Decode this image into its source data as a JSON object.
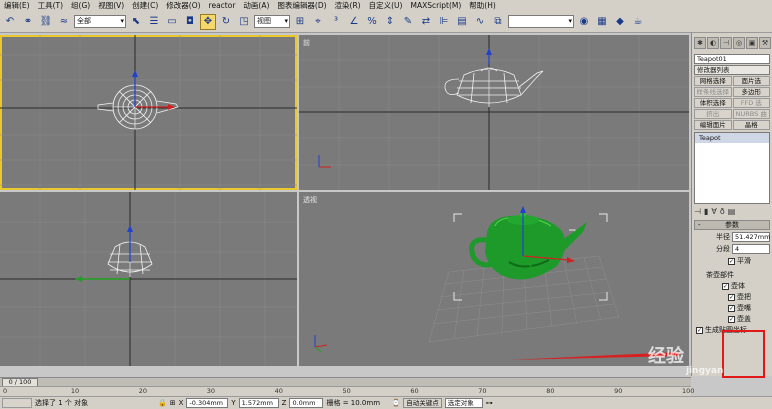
{
  "menu": [
    "编辑(E)",
    "工具(T)",
    "组(G)",
    "视图(V)",
    "创建(C)",
    "修改器(O)",
    "reactor",
    "动画(A)",
    "图表编辑器(D)",
    "渲染(R)",
    "自定义(U)",
    "MAXScript(M)",
    "帮助(H)"
  ],
  "toolbar": {
    "filter_select": "全部",
    "coord_select": "视图",
    "named_selection": ""
  },
  "viewports": {
    "top_label": "",
    "front_label": "前",
    "left_label": "",
    "perspective_label": "透视"
  },
  "command_panel": {
    "object_name": "Teapot01",
    "modifier_list": "修改器列表",
    "buttons": [
      [
        "网格选择",
        "面片选"
      ],
      [
        "样条线选择",
        "多边形"
      ],
      [
        "体积选择",
        "FFD 选"
      ],
      [
        "挤出",
        "NURBS 曲"
      ],
      [
        "编辑面片",
        "晶格"
      ]
    ],
    "stack_item": "Teapot",
    "rollout_title": "参数",
    "radius_label": "半径",
    "radius_value": "51.427mm",
    "segments_label": "分段",
    "segments_value": "4",
    "smooth_label": "平滑",
    "parts_group": "茶壶部件",
    "parts": [
      "壶体",
      "壶把",
      "壶嘴",
      "壶盖"
    ],
    "gen_mapping": "生成贴图坐标"
  },
  "timeline": {
    "frame_display": "0 / 100",
    "ticks": [
      "0",
      "10",
      "20",
      "30",
      "40",
      "50",
      "60",
      "70",
      "80",
      "90",
      "100"
    ]
  },
  "status": {
    "selection_text": "选择了 1 个 对象",
    "x_label": "X",
    "x_value": "-0.304mm",
    "y_label": "Y",
    "y_value": "1.572mm",
    "z_label": "Z",
    "z_value": "0.0mm",
    "grid_text": "栅格 = 10.0mm",
    "autokey_label": "自动关键点",
    "selected_select": "选定对象"
  },
  "watermark": {
    "brand": "经验",
    "site": "jingyan"
  },
  "colors": {
    "viewport_bg": "#7a7a7a",
    "active_border": "#e8c82a",
    "teapot_green": "#1d9a2a",
    "annotation_red": "#e01818"
  }
}
